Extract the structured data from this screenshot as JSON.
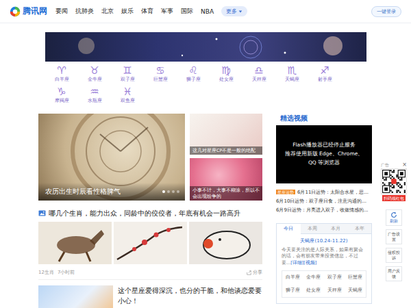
{
  "nav": {
    "logo": "腾讯网",
    "items": [
      "要闻",
      "抗肺炎",
      "北京",
      "娱乐",
      "体育",
      "军事",
      "国际",
      "NBA"
    ],
    "more": "更多",
    "login": "一键登录"
  },
  "zodiac": [
    {
      "symbol": "♈",
      "name": "白羊座"
    },
    {
      "symbol": "♉",
      "name": "金牛座"
    },
    {
      "symbol": "♊",
      "name": "双子座"
    },
    {
      "symbol": "♋",
      "name": "巨蟹座"
    },
    {
      "symbol": "♌",
      "name": "狮子座"
    },
    {
      "symbol": "♍",
      "name": "处女座"
    },
    {
      "symbol": "♎",
      "name": "天秤座"
    },
    {
      "symbol": "♏",
      "name": "天蝎座"
    },
    {
      "symbol": "♐",
      "name": "射手座"
    },
    {
      "symbol": "♑",
      "name": "摩羯座"
    },
    {
      "symbol": "♒",
      "name": "水瓶座"
    },
    {
      "symbol": "♓",
      "name": "双鱼座"
    }
  ],
  "feature": {
    "caption": "农历出生时辰看性格脾气",
    "dots": [
      {
        "selected": true
      },
      {
        "selected": false
      },
      {
        "selected": false
      },
      {
        "selected": false
      }
    ]
  },
  "side_cards": [
    {
      "caption": "这几对星座CP不是一般的绝配"
    },
    {
      "caption": "小事不计，大事不糊涂，所以不会出现纷争的"
    }
  ],
  "article1": {
    "title": "哪几个生肖，能力出众，同龄中的佼佼者，年底有机会一路高升",
    "tag": "12生肖",
    "time": "7小时前",
    "share": "分享"
  },
  "article2": {
    "title": "这个星座爱得深沉，也分的干脆，和他谈恋爱要小心！"
  },
  "video": {
    "heading": "精选视频",
    "notice": [
      "Flash播放器已经停止服务",
      "推荐使用新版 Edge、Chrome、QQ 等浏览器"
    ],
    "items": [
      {
        "badge": "星座运势",
        "text": "6月11日运势：太阳合水星，思..."
      },
      {
        "text": "6月10日运势：双子座日食，注意沟通的..."
      },
      {
        "text": "6月9日运势：月亮进入双子，收敛情感的..."
      }
    ]
  },
  "fortune": {
    "tabs": [
      {
        "label": "今日",
        "selected": true
      },
      {
        "label": "本周",
        "selected": false
      },
      {
        "label": "本月",
        "selected": false
      },
      {
        "label": "本年",
        "selected": false
      }
    ],
    "sign": "天蝎座(10.24-11.22)",
    "text": "今天要关注的是人际关系，如果有聚会的话，会有朋友带来投资信息，不过要...",
    "links": [
      "[详细]",
      "[视频]"
    ],
    "signs": [
      "白羊座",
      "金牛座",
      "双子座",
      "巨蟹座",
      "狮子座",
      "处女座",
      "天秤座",
      "天蝎座"
    ]
  },
  "float": {
    "ad_label": "广告",
    "close": "×",
    "qr_caption": "扫码领红包",
    "refresh": "刷新",
    "links": [
      "广告设置",
      "侵权投诉",
      "用户反馈"
    ]
  }
}
